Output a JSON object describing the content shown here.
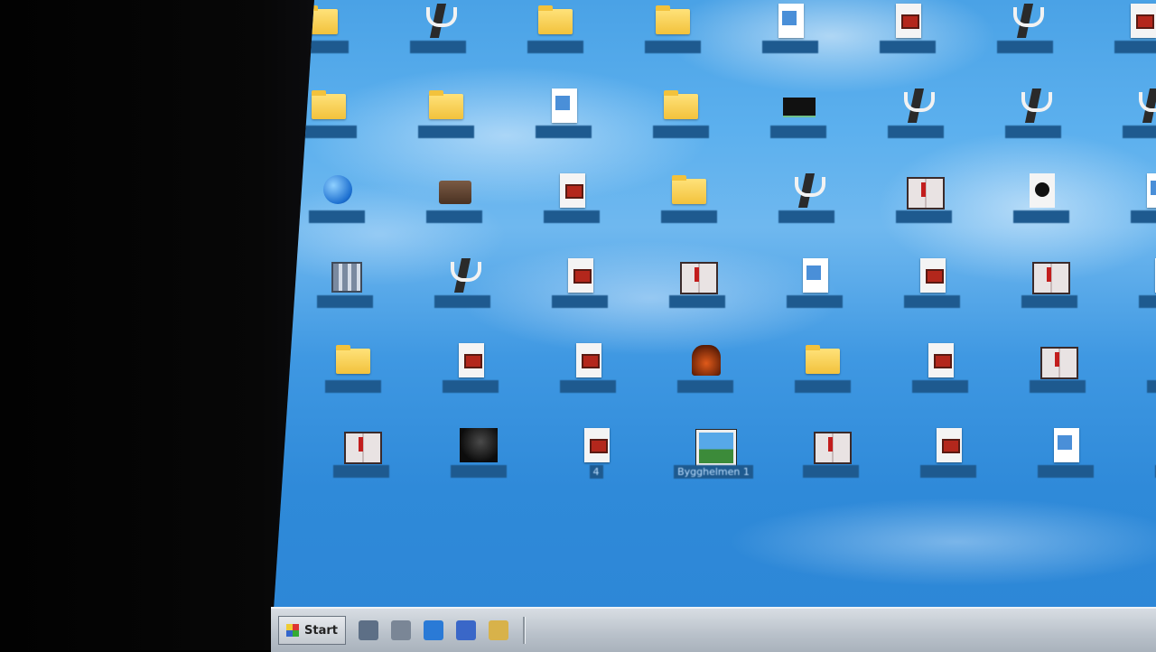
{
  "desktop": {
    "icons": [
      {
        "label": "",
        "type": "folder"
      },
      {
        "label": "",
        "type": "tulip"
      },
      {
        "label": "",
        "type": "folder"
      },
      {
        "label": "",
        "type": "folder"
      },
      {
        "label": "",
        "type": "page"
      },
      {
        "label": "",
        "type": "doc"
      },
      {
        "label": "",
        "type": "tulip"
      },
      {
        "label": "",
        "type": "doc"
      },
      {
        "label": "",
        "type": "folder"
      },
      {
        "label": "",
        "type": "folder"
      },
      {
        "label": "",
        "type": "page"
      },
      {
        "label": "",
        "type": "folder"
      },
      {
        "label": "",
        "type": "black"
      },
      {
        "label": "",
        "type": "tulip"
      },
      {
        "label": "",
        "type": "tulip"
      },
      {
        "label": "",
        "type": "tulip"
      },
      {
        "label": "",
        "type": "globe"
      },
      {
        "label": "",
        "type": "chest"
      },
      {
        "label": "",
        "type": "doc"
      },
      {
        "label": "",
        "type": "folder"
      },
      {
        "label": "",
        "type": "tulip"
      },
      {
        "label": "",
        "type": "book"
      },
      {
        "label": "",
        "type": "disc"
      },
      {
        "label": "",
        "type": "page"
      },
      {
        "label": "",
        "type": "mixed"
      },
      {
        "label": "",
        "type": "tulip"
      },
      {
        "label": "",
        "type": "doc"
      },
      {
        "label": "",
        "type": "book"
      },
      {
        "label": "",
        "type": "page"
      },
      {
        "label": "",
        "type": "doc"
      },
      {
        "label": "",
        "type": "book"
      },
      {
        "label": "",
        "type": "page"
      },
      {
        "label": "",
        "type": "folder"
      },
      {
        "label": "",
        "type": "doc"
      },
      {
        "label": "",
        "type": "doc"
      },
      {
        "label": "",
        "type": "fire"
      },
      {
        "label": "",
        "type": "folder"
      },
      {
        "label": "",
        "type": "doc"
      },
      {
        "label": "",
        "type": "book"
      },
      {
        "label": "",
        "type": "page"
      },
      {
        "label": "",
        "type": "book"
      },
      {
        "label": "",
        "type": "dark"
      },
      {
        "label": "4",
        "type": "doc"
      },
      {
        "label": "Bygghelmen 1",
        "type": "pict"
      },
      {
        "label": "",
        "type": "book"
      },
      {
        "label": "",
        "type": "doc"
      },
      {
        "label": "",
        "type": "page"
      },
      {
        "label": "",
        "type": "page"
      }
    ]
  },
  "taskbar": {
    "start_label": "Start",
    "quicklaunch": [
      {
        "icon": "desktop-icon",
        "color": "#5d6f86"
      },
      {
        "icon": "network-icon",
        "color": "#7a8696"
      },
      {
        "icon": "ie-icon",
        "color": "#2a7ad6"
      },
      {
        "icon": "media-player-icon",
        "color": "#3a67c8"
      },
      {
        "icon": "folder-icon",
        "color": "#d8b24a"
      }
    ]
  }
}
